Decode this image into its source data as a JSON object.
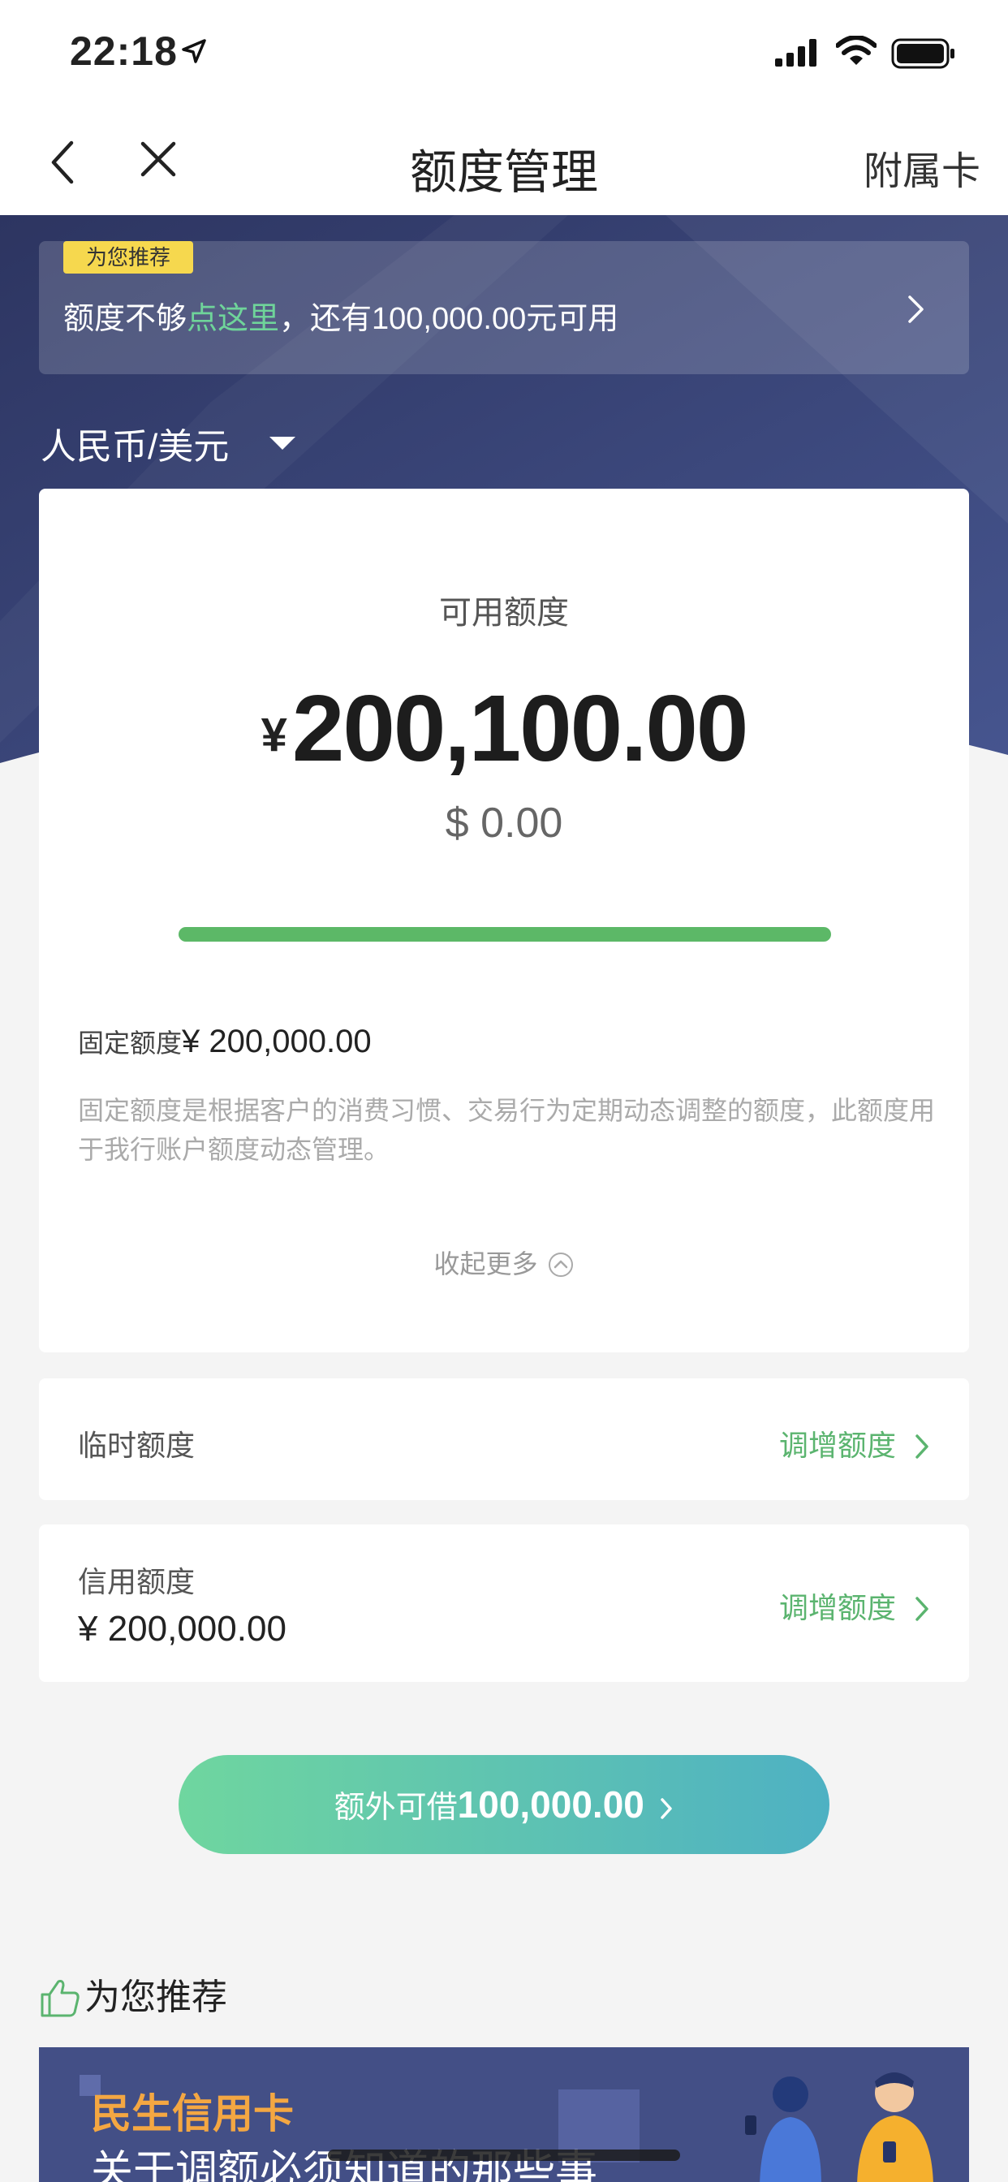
{
  "status_bar": {
    "time": "22:18"
  },
  "nav": {
    "title": "额度管理",
    "right_link": "附属卡"
  },
  "promo": {
    "tag": "为您推荐",
    "text_prefix": "额度不够",
    "text_highlight": "点这里",
    "text_suffix": "，还有100,000.00元可用"
  },
  "currency_selector": {
    "value": "人民币/美元"
  },
  "card": {
    "available_label": "可用额度",
    "currency_symbol": "¥",
    "available_amount": "200,100.00",
    "usd_amount": "$ 0.00",
    "usage_fraction": 1.0,
    "fixed_label": "固定额度",
    "fixed_value": "¥ 200,000.00",
    "fixed_description": "固定额度是根据客户的消费习惯、交易行为定期动态调整的额度，此额度用于我行账户额度动态管理。",
    "collapse_label": "收起更多"
  },
  "temp_limit": {
    "label": "临时额度",
    "action": "调增额度"
  },
  "credit_limit": {
    "label": "信用额度",
    "value": "¥ 200,000.00",
    "action": "调增额度"
  },
  "extra_loan": {
    "label": "额外可借",
    "amount": "100,000.00"
  },
  "recommend": {
    "title": "为您推荐",
    "banner_title": "民生信用卡",
    "banner_subtitle": "关于调额必须知道的那些事"
  },
  "colors": {
    "accent_green": "#5bb46f",
    "hero_navy": "#3e4c84",
    "tag_yellow": "#f6d84e",
    "banner_orange": "#f4a742"
  }
}
